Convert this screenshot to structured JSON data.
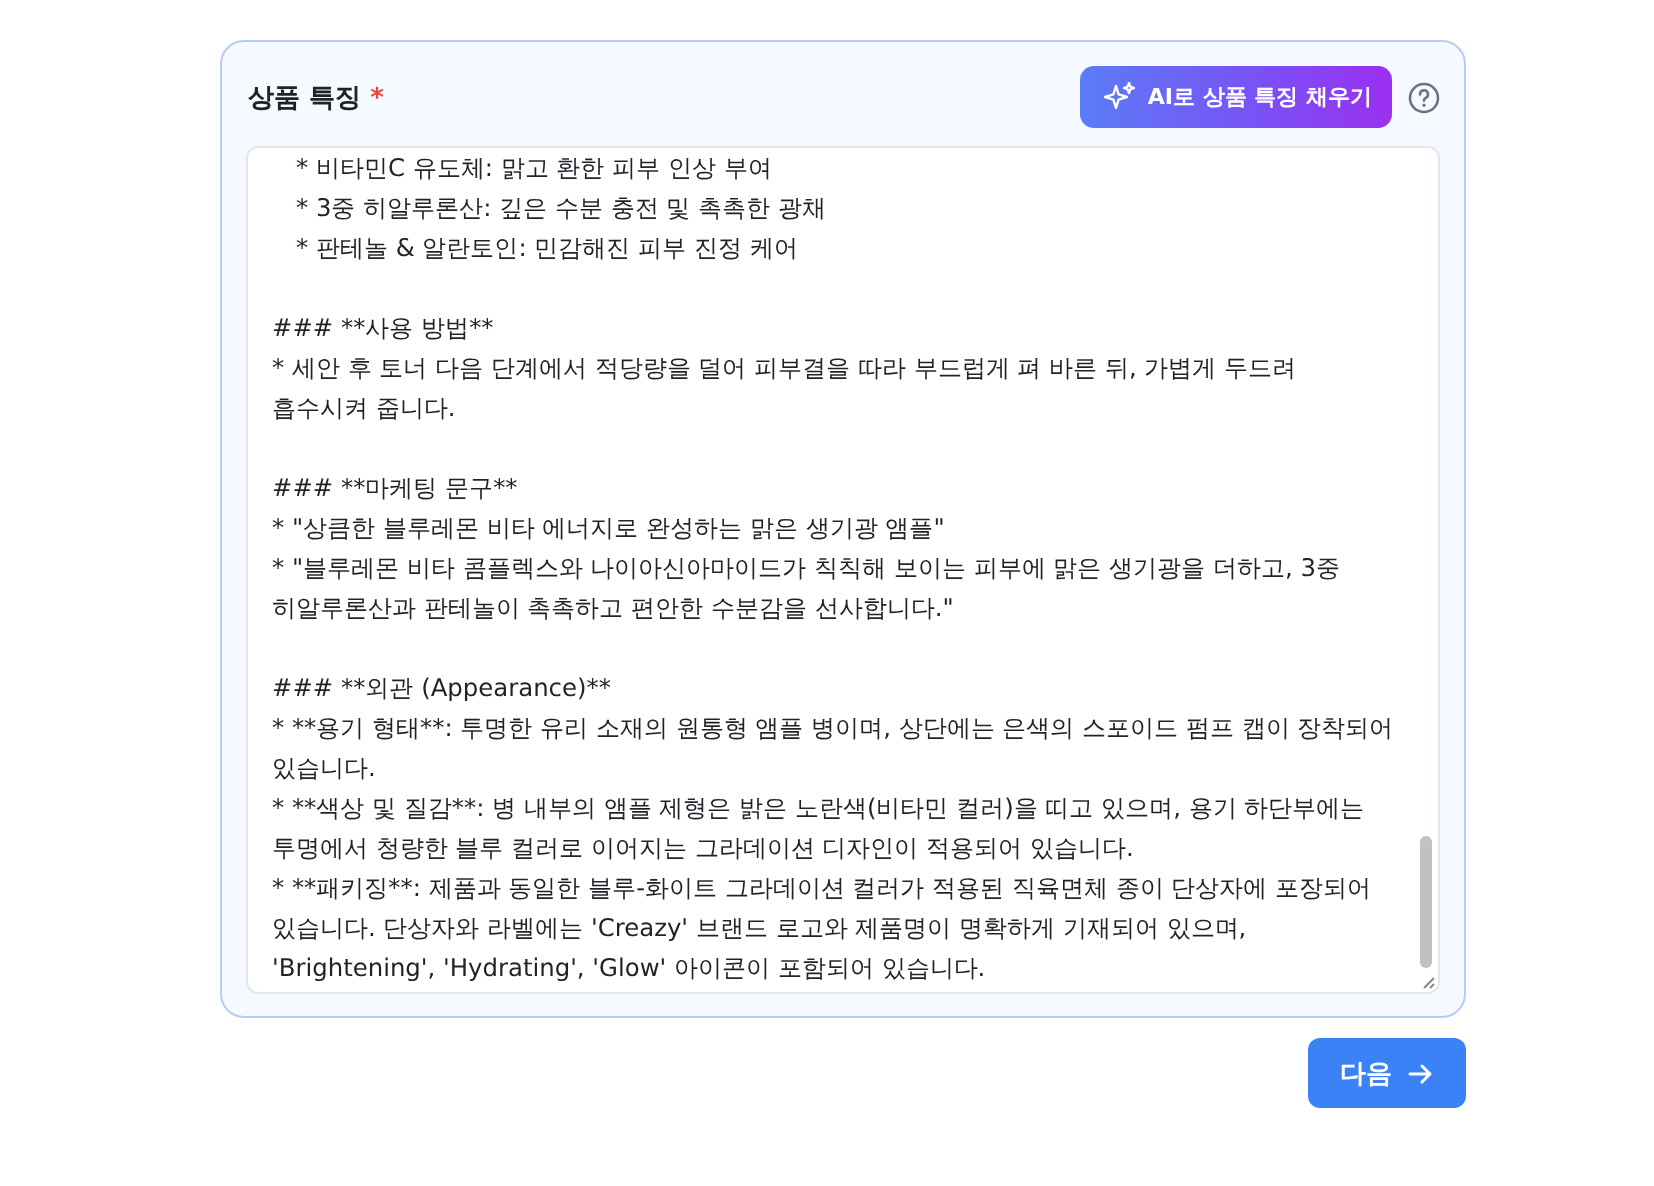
{
  "field": {
    "label": "상품 특징",
    "required_mark": "*",
    "ai_button": "AI로 상품 특징 채우기",
    "content": [
      {
        "kind": "nested",
        "lines": [
          "* 비타민C 유도체: 맑고 환한 피부 인상 부여"
        ]
      },
      {
        "kind": "nested",
        "lines": [
          "* 3중 히알루론산: 깊은 수분 충전 및 촉촉한 광채"
        ]
      },
      {
        "kind": "nested",
        "lines": [
          "* 판테놀 & 알란토인: 민감해진 피부 진정 케어"
        ]
      },
      {
        "kind": "gap"
      },
      {
        "kind": "plain",
        "lines": [
          "### **사용 방법**"
        ]
      },
      {
        "kind": "plain",
        "lines": [
          "* 세안 후 토너 다음 단계에서 적당량을 덜어 피부결을 따라 부드럽게 펴 바른 뒤, 가볍게 두드려",
          "흡수시켜 줍니다."
        ]
      },
      {
        "kind": "gap"
      },
      {
        "kind": "plain",
        "lines": [
          "### **마케팅 문구**"
        ]
      },
      {
        "kind": "plain",
        "lines": [
          "* \"상큼한 블루레몬 비타 에너지로 완성하는 맑은 생기광 앰플\""
        ]
      },
      {
        "kind": "plain",
        "lines": [
          "* \"블루레몬 비타 콤플렉스와 나이아신아마이드가 칙칙해 보이는 피부에 맑은 생기광을 더하고, 3중",
          "히알루론산과 판테놀이 촉촉하고 편안한 수분감을 선사합니다.\""
        ]
      },
      {
        "kind": "gap"
      },
      {
        "kind": "plain",
        "lines": [
          "### **외관 (Appearance)**"
        ]
      },
      {
        "kind": "plain",
        "lines": [
          "* **용기 형태**: 투명한 유리 소재의 원통형 앰플 병이며, 상단에는 은색의 스포이드 펌프 캡이 장착되어",
          "있습니다."
        ]
      },
      {
        "kind": "plain",
        "lines": [
          "* **색상 및 질감**: 병 내부의 앰플 제형은 밝은 노란색(비타민 컬러)을 띠고 있으며, 용기 하단부에는",
          "투명에서 청량한 블루 컬러로 이어지는 그라데이션 디자인이 적용되어 있습니다."
        ]
      },
      {
        "kind": "plain",
        "lines": [
          "* **패키징**: 제품과 동일한 블루-화이트 그라데이션 컬러가 적용된 직육면체 종이 단상자에 포장되어",
          "있습니다. 단상자와 라벨에는 'Creazy' 브랜드 로고와 제품명이 명확하게 기재되어 있으며,",
          "'Brightening', 'Hydrating', 'Glow' 아이콘이 포함되어 있습니다."
        ]
      }
    ]
  },
  "next_button": "다음"
}
